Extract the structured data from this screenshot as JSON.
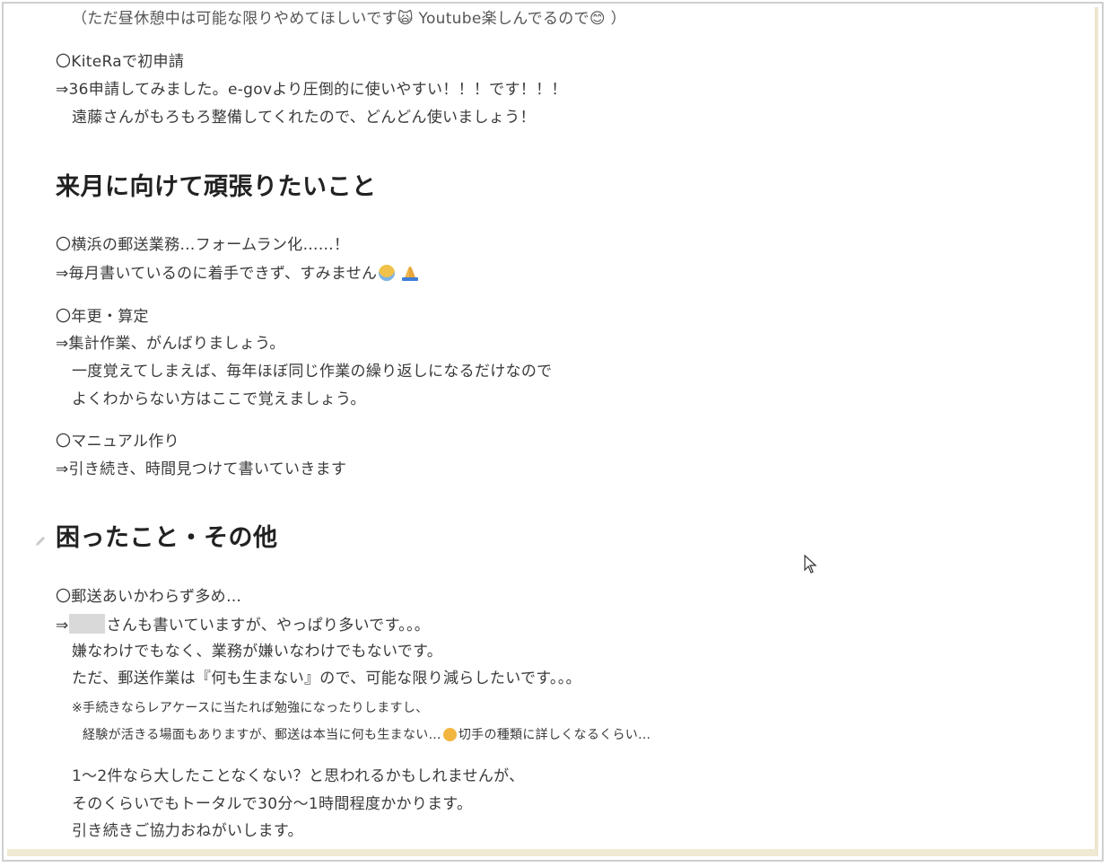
{
  "lines": {
    "l0": "（ただ昼休憩中は可能な限りやめてほしいです🙀 Youtube楽しんでるので😊 ）",
    "l1": "〇KiteRaで初申請",
    "l2": "⇒36申請してみました。e-govより圧倒的に使いやすい！！！です！！！",
    "l3": "遠藤さんがもろもろ整備してくれたので、どんどん使いましょう！",
    "l4": "〇横浜の郵送業務…フォームラン化……！",
    "l5": "⇒毎月書いているのに着手できず、すみません",
    "l6": "〇年更・算定",
    "l7": "⇒集計作業、がんばりましょう。",
    "l8": "一度覚えてしまえば、毎年ほぼ同じ作業の繰り返しになるだけなので",
    "l9": "よくわからない方はここで覚えましょう。",
    "l10": "〇マニュアル作り",
    "l11": "⇒引き続き、時間見つけて書いていきます",
    "l12": "〇郵送あいかわらず多め…",
    "l13a": "⇒",
    "l13b": "さんも書いていますが、やっぱり多いです。。。",
    "l14": "嫌なわけでもなく、業務が嫌いなわけでもないです。",
    "l15": "ただ、郵送作業は『何も生まない』ので、可能な限り減らしたいです。。。",
    "l16": "※手続きならレアケースに当たれば勉強になったりしますし、",
    "l17a": "経験が活きる場面もありますが、郵送は本当に何も生まない…",
    "l17b": "切手の種類に詳しくなるくらい…",
    "l18": "1～2件なら大したことなくない？と思われるかもしれませんが、",
    "l19": "そのくらいでもトータルで30分～1時間程度かかります。",
    "l20": "引き続きご協力おねがいします。"
  },
  "headings": {
    "h1": "来月に向けて頑張りたいこと",
    "h2": "困ったこと・その他"
  },
  "icons": {
    "pencil": "pencil-icon",
    "cursor": "mouse-cursor-icon",
    "crying_face": "crying-face-emoji",
    "folded_hands": "folded-hands-emoji",
    "disappointed": "disappointed-face-emoji"
  },
  "colors": {
    "text": "#3a3a3a",
    "heading": "#222222",
    "frame_border": "#cfcfcf",
    "frame_accent": "#f1ead2"
  }
}
